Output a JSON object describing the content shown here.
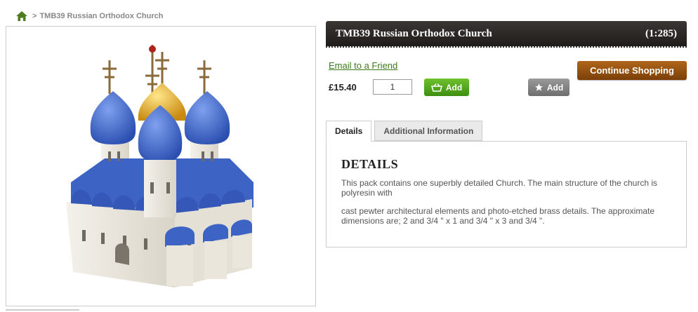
{
  "breadcrumb": {
    "separator": ">",
    "current": "TMB39 Russian Orthodox Church"
  },
  "product": {
    "title": "TMB39 Russian Orthodox Church",
    "scale": "(1:285)",
    "price": "£15.40",
    "quantity": "1"
  },
  "actions": {
    "email_friend": "Email to a Friend",
    "continue_shopping": "Continue Shopping",
    "add_cart": "Add",
    "add_wishlist": "Add"
  },
  "tabs": [
    {
      "label": "Details",
      "active": true
    },
    {
      "label": "Additional Information",
      "active": false
    }
  ],
  "details": {
    "heading": "DETAILS",
    "paragraph1": "This pack contains one superbly detailed Church. The main structure of the church is polyresin with",
    "paragraph2": "cast pewter architectural elements and photo-etched brass details. The approximate dimensions are; 2 and 3/4 \" x 1 and 3/4 \" x 3 and 3/4 \"."
  },
  "colors": {
    "accent_green": "#3e8e10",
    "continue_brown": "#7a3f08",
    "title_bar": "#2a2623",
    "dome_blue": "#3f66c9",
    "dome_gold": "#d9a21a"
  },
  "icons": [
    "home-icon",
    "basket-icon",
    "star-icon"
  ]
}
